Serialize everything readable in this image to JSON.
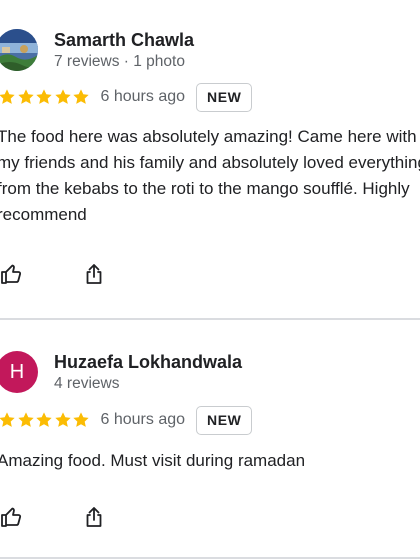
{
  "reviews": [
    {
      "author": "Samarth Chawla",
      "meta": "7 reviews · 1 photo",
      "avatar": {
        "type": "photo",
        "icon": "profile-photo"
      },
      "rating": 5,
      "time": "6 hours ago",
      "badge": "NEW",
      "text": "The food here was absolutely amazing! Came here with\nmy friends and his family and absolutely loved everything,\nfrom the kebabs to the roti to the mango soufflé. Highly\nrecommend",
      "actions": {
        "like_icon": "thumbs-up-icon",
        "share_icon": "share-icon"
      }
    },
    {
      "author": "Huzaefa Lokhandwala",
      "meta": "4 reviews",
      "avatar": {
        "type": "initial",
        "letter": "H",
        "color": "#c2185b"
      },
      "rating": 5,
      "time": "6 hours ago",
      "badge": "NEW",
      "text": "Amazing food. Must visit during ramadan",
      "actions": {
        "like_icon": "thumbs-up-icon",
        "share_icon": "share-icon"
      }
    }
  ],
  "colors": {
    "star": "#fbbc04",
    "secondary_text": "#5f6368",
    "divider": "#dadce0"
  }
}
